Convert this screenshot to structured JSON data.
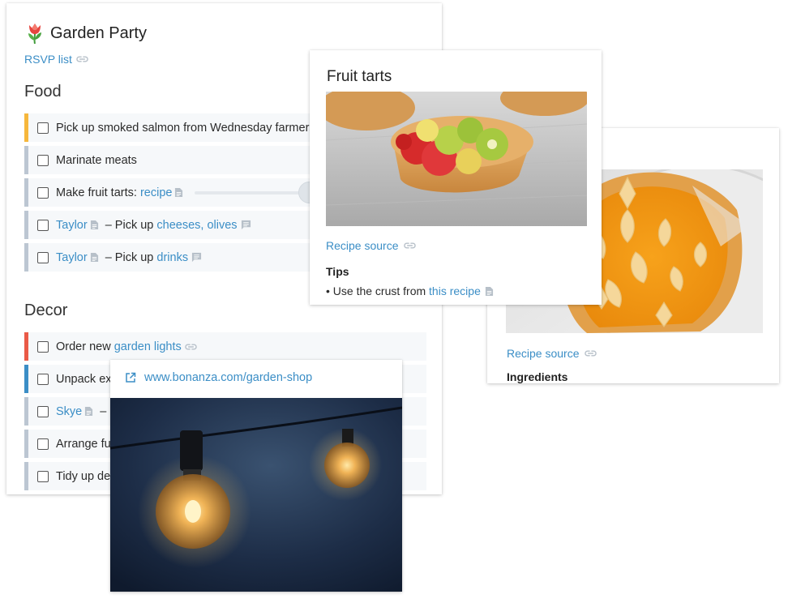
{
  "main": {
    "title": "Garden Party",
    "rsvp_link": "RSVP list",
    "sections": {
      "food": {
        "title": "Food",
        "tasks": [
          {
            "text": "Pick up smoked salmon from Wednesday farmers market",
            "accent": "#f6b73c"
          },
          {
            "text": "Marinate meats",
            "accent": "#bcc6d2"
          },
          {
            "text": "Make fruit tarts: ",
            "link": "recipe",
            "accent": "#bcc6d2"
          },
          {
            "person": "Taylor",
            "text": " – Pick up ",
            "link": "cheeses, olives",
            "accent": "#bcc6d2"
          },
          {
            "person": "Taylor",
            "text": " – Pick up ",
            "link": "drinks",
            "accent": "#bcc6d2"
          }
        ]
      },
      "decor": {
        "title": "Decor",
        "tasks": [
          {
            "text": "Order new ",
            "link": "garden lights",
            "accent": "#ea5a47"
          },
          {
            "text": "Unpack ext",
            "accent": "#3b8ec6"
          },
          {
            "person": "Skye",
            "text": " – P",
            "accent": "#bcc6d2"
          },
          {
            "text": "Arrange fu",
            "accent": "#bcc6d2"
          },
          {
            "text": "Tidy up de",
            "accent": "#bcc6d2"
          }
        ]
      }
    }
  },
  "tarts_card": {
    "title": "Fruit tarts",
    "source_link": "Recipe source",
    "tips_heading": "Tips",
    "tip_prefix": "• Use the crust from ",
    "tip_link": "this recipe"
  },
  "pie_card": {
    "source_link": "Recipe source",
    "ingredients_heading": "Ingredients"
  },
  "lights_card": {
    "url": "www.bonanza.com/garden-shop"
  },
  "colors": {
    "link": "#3b8ec6",
    "accent_yellow": "#f6b73c",
    "accent_red": "#ea5a47",
    "accent_blue": "#3b8ec6",
    "accent_gray": "#bcc6d2"
  },
  "icons": {
    "title_emoji": "tulip-icon",
    "link": "link-icon",
    "document": "document-icon",
    "comment": "comment-icon",
    "external": "external-link-icon"
  }
}
